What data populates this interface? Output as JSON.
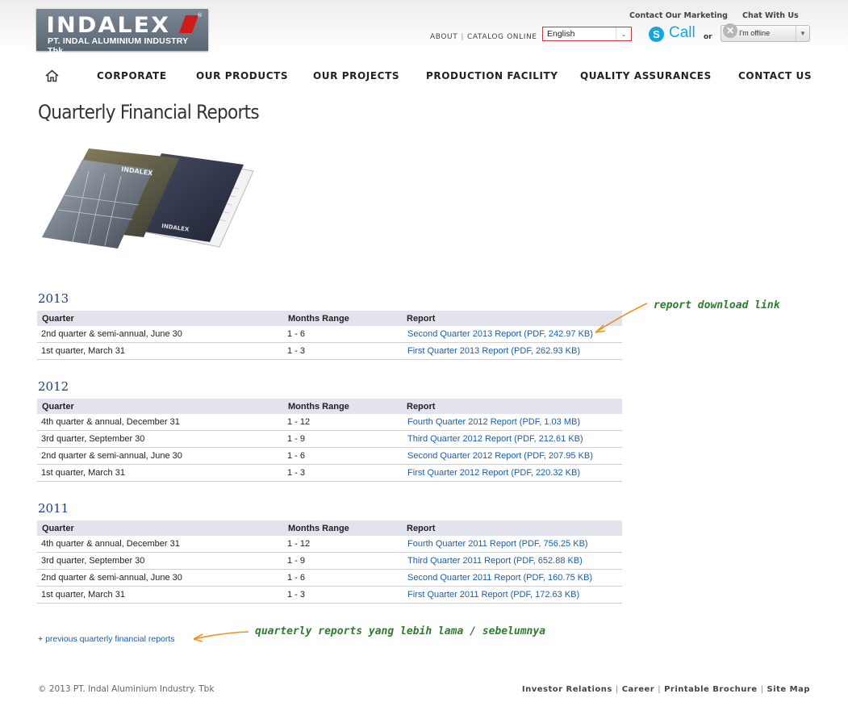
{
  "header": {
    "logo_text": "INDALEX",
    "logo_subtext": "PT. INDAL ALUMINIUM INDUSTRY Tbk.",
    "contact_marketing": "Contact Our Marketing",
    "chat_with_us": "Chat With Us",
    "about": "ABOUT",
    "catalog_online": "CATALOG ONLINE",
    "language": "English",
    "skype_call": "Call",
    "or_label": "or",
    "chat_status": "I'm offline"
  },
  "nav": {
    "items": [
      "CORPORATE",
      "OUR PRODUCTS",
      "OUR PROJECTS",
      "PRODUCTION FACILITY",
      "QUALITY ASSURANCES",
      "CONTACT US"
    ]
  },
  "page": {
    "title": "Quarterly Financial Reports"
  },
  "table_headers": {
    "quarter": "Quarter",
    "months_range": "Months Range",
    "report": "Report"
  },
  "sections": [
    {
      "year": "2013",
      "rows": [
        {
          "quarter": "2nd quarter & semi-annual, June 30",
          "range": "1 - 6",
          "report": "Second Quarter 2013 Report (PDF, 242.97 KB)"
        },
        {
          "quarter": "1st quarter, March 31",
          "range": "1 - 3",
          "report": "First Quarter 2013 Report (PDF, 262.93 KB)"
        }
      ]
    },
    {
      "year": "2012",
      "rows": [
        {
          "quarter": "4th quarter & annual, December 31",
          "range": "1 - 12",
          "report": "Fourth Quarter 2012 Report (PDF, 1.03 MB)"
        },
        {
          "quarter": "3rd quarter, September 30",
          "range": "1 - 9",
          "report": "Third Quarter 2012 Report (PDF, 212.61 KB)"
        },
        {
          "quarter": "2nd quarter & semi-annual, June 30",
          "range": "1 - 6",
          "report": "Second Quarter 2012 Report (PDF, 207.95 KB)"
        },
        {
          "quarter": "1st quarter, March 31",
          "range": "1 - 3",
          "report": "First Quarter 2012 Report (PDF, 220.32 KB)"
        }
      ]
    },
    {
      "year": "2011",
      "rows": [
        {
          "quarter": "4th quarter & annual, December 31",
          "range": "1 - 12",
          "report": "Fourth Quarter 2011 Report (PDF, 756.25 KB)"
        },
        {
          "quarter": "3rd quarter, September 30",
          "range": "1 - 9",
          "report": "Third Quarter 2011 Report (PDF, 652.88 KB)"
        },
        {
          "quarter": "2nd quarter & semi-annual, June 30",
          "range": "1 - 6",
          "report": "Second Quarter 2011 Report (PDF, 160.75 KB)"
        },
        {
          "quarter": "1st quarter, March 31",
          "range": "1 - 3",
          "report": "First Quarter 2011 Report (PDF, 172.63 KB)"
        }
      ]
    }
  ],
  "annotations": {
    "download_link": "report download link",
    "older_reports": "quarterly reports yang lebih lama / sebelumnya"
  },
  "previous_link": {
    "plus": "+",
    "label": "previous quarterly financial reports"
  },
  "footer": {
    "copyright": "© 2013 PT. Indal Aluminium Industry. Tbk",
    "links": [
      "Investor Relations",
      "Career",
      "Printable Brochure",
      "Site Map"
    ]
  },
  "colors": {
    "link": "#1c5ea6",
    "year_heading": "#1f3f7a",
    "annotation": "#2e7d2e",
    "arrow": "#f0901e",
    "table_header_bg": "#e3e3ee"
  }
}
